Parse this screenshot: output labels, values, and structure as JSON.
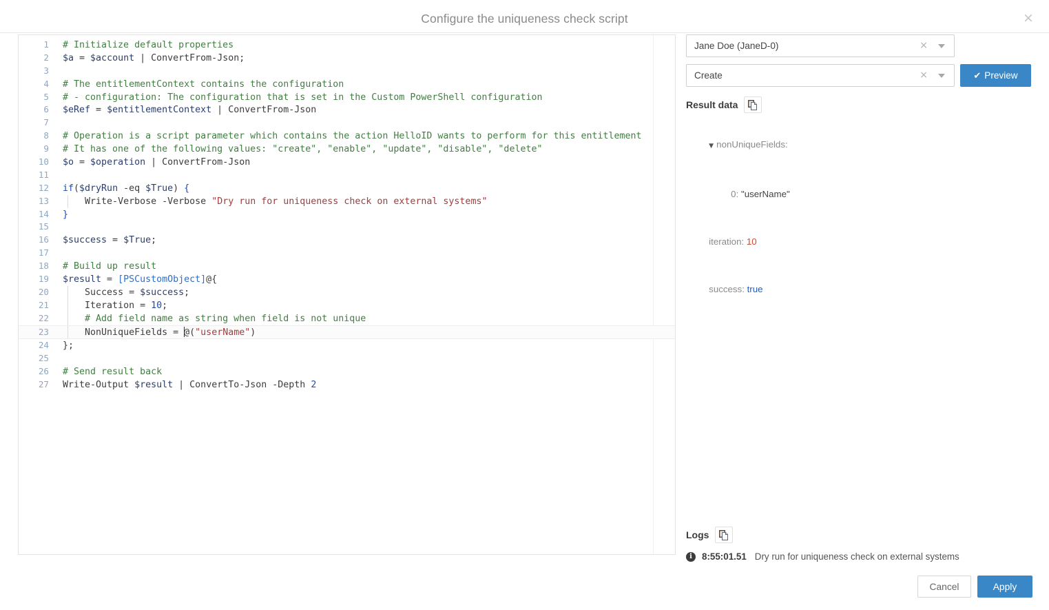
{
  "dialog": {
    "title": "Configure the uniqueness check script",
    "close_label": "×"
  },
  "editor": {
    "language": "powershell",
    "active_line": 23,
    "lines": [
      {
        "n": "1",
        "tokens": [
          {
            "t": "# Initialize default properties",
            "c": "tk-com"
          }
        ]
      },
      {
        "n": "2",
        "tokens": [
          {
            "t": "$a",
            "c": "tk-var"
          },
          {
            "t": " = ",
            "c": "tk-op"
          },
          {
            "t": "$account",
            "c": "tk-var"
          },
          {
            "t": " | ",
            "c": "tk-op"
          },
          {
            "t": "ConvertFrom-Json;",
            "c": "tk-cmd"
          }
        ]
      },
      {
        "n": "3",
        "tokens": []
      },
      {
        "n": "4",
        "tokens": [
          {
            "t": "# The entitlementContext contains the configuration",
            "c": "tk-com"
          }
        ]
      },
      {
        "n": "5",
        "tokens": [
          {
            "t": "# - configuration: The configuration that is set in the Custom PowerShell configuration",
            "c": "tk-com"
          }
        ]
      },
      {
        "n": "6",
        "tokens": [
          {
            "t": "$eRef",
            "c": "tk-var"
          },
          {
            "t": " = ",
            "c": "tk-op"
          },
          {
            "t": "$entitlementContext",
            "c": "tk-var"
          },
          {
            "t": " | ",
            "c": "tk-op"
          },
          {
            "t": "ConvertFrom-Json",
            "c": "tk-cmd"
          }
        ]
      },
      {
        "n": "7",
        "tokens": []
      },
      {
        "n": "8",
        "tokens": [
          {
            "t": "# Operation is a script parameter which contains the action HelloID wants to perform for this entitlement",
            "c": "tk-com"
          }
        ]
      },
      {
        "n": "9",
        "tokens": [
          {
            "t": "# It has one of the following values: \"create\", \"enable\", \"update\", \"disable\", \"delete\"",
            "c": "tk-com"
          }
        ]
      },
      {
        "n": "10",
        "tokens": [
          {
            "t": "$o",
            "c": "tk-var"
          },
          {
            "t": " = ",
            "c": "tk-op"
          },
          {
            "t": "$operation",
            "c": "tk-var"
          },
          {
            "t": " | ",
            "c": "tk-op"
          },
          {
            "t": "ConvertFrom-Json",
            "c": "tk-cmd"
          }
        ]
      },
      {
        "n": "11",
        "tokens": []
      },
      {
        "n": "12",
        "tokens": [
          {
            "t": "if",
            "c": "tk-kw"
          },
          {
            "t": "(",
            "c": "tk-pun"
          },
          {
            "t": "$dryRun",
            "c": "tk-var"
          },
          {
            "t": " -eq ",
            "c": "tk-op"
          },
          {
            "t": "$True",
            "c": "tk-var"
          },
          {
            "t": ") ",
            "c": "tk-pun"
          },
          {
            "t": "{",
            "c": "tk-kw"
          }
        ]
      },
      {
        "n": "13",
        "guide": 1,
        "tokens": [
          {
            "t": "    ",
            "c": "tk-pun"
          },
          {
            "t": "Write-Verbose",
            "c": "tk-cmd"
          },
          {
            "t": " ",
            "c": "tk-op"
          },
          {
            "t": "-Verbose",
            "c": "tk-cmd"
          },
          {
            "t": " ",
            "c": "tk-op"
          },
          {
            "t": "\"Dry run for uniqueness check on external systems\"",
            "c": "tk-str"
          }
        ]
      },
      {
        "n": "14",
        "tokens": [
          {
            "t": "}",
            "c": "tk-kw"
          }
        ]
      },
      {
        "n": "15",
        "tokens": []
      },
      {
        "n": "16",
        "tokens": [
          {
            "t": "$success",
            "c": "tk-var"
          },
          {
            "t": " = ",
            "c": "tk-op"
          },
          {
            "t": "$True",
            "c": "tk-var"
          },
          {
            "t": ";",
            "c": "tk-pun"
          }
        ]
      },
      {
        "n": "17",
        "tokens": []
      },
      {
        "n": "18",
        "tokens": [
          {
            "t": "# Build up result",
            "c": "tk-com"
          }
        ]
      },
      {
        "n": "19",
        "tokens": [
          {
            "t": "$result",
            "c": "tk-var"
          },
          {
            "t": " = ",
            "c": "tk-op"
          },
          {
            "t": "[PSCustomObject]",
            "c": "tk-type"
          },
          {
            "t": "@{",
            "c": "tk-pun"
          }
        ]
      },
      {
        "n": "20",
        "guide": 1,
        "tokens": [
          {
            "t": "    ",
            "c": "tk-pun"
          },
          {
            "t": "Success",
            "c": "tk-cmd"
          },
          {
            "t": " = ",
            "c": "tk-op"
          },
          {
            "t": "$success",
            "c": "tk-var"
          },
          {
            "t": ";",
            "c": "tk-pun"
          }
        ]
      },
      {
        "n": "21",
        "guide": 1,
        "tokens": [
          {
            "t": "    ",
            "c": "tk-pun"
          },
          {
            "t": "Iteration",
            "c": "tk-cmd"
          },
          {
            "t": " = ",
            "c": "tk-op"
          },
          {
            "t": "10",
            "c": "tk-num"
          },
          {
            "t": ";",
            "c": "tk-pun"
          }
        ]
      },
      {
        "n": "22",
        "guide": 1,
        "tokens": [
          {
            "t": "    ",
            "c": "tk-pun"
          },
          {
            "t": "# Add field name as string when field is not unique",
            "c": "tk-com"
          }
        ]
      },
      {
        "n": "23",
        "guide": 1,
        "active": true,
        "tokens": [
          {
            "t": "    ",
            "c": "tk-pun"
          },
          {
            "t": "NonUniqueFields",
            "c": "tk-cmd"
          },
          {
            "t": " = ",
            "c": "tk-op"
          },
          {
            "t": "@(",
            "c": "tk-pun"
          },
          {
            "t": "\"userName\"",
            "c": "tk-str"
          },
          {
            "t": ")",
            "c": "tk-pun"
          }
        ]
      },
      {
        "n": "24",
        "tokens": [
          {
            "t": "};",
            "c": "tk-pun"
          }
        ]
      },
      {
        "n": "25",
        "tokens": []
      },
      {
        "n": "26",
        "tokens": [
          {
            "t": "# Send result back",
            "c": "tk-com"
          }
        ]
      },
      {
        "n": "27",
        "tokens": [
          {
            "t": "Write-Output",
            "c": "tk-cmd"
          },
          {
            "t": " ",
            "c": "tk-op"
          },
          {
            "t": "$result",
            "c": "tk-var"
          },
          {
            "t": " | ",
            "c": "tk-op"
          },
          {
            "t": "ConvertTo-Json",
            "c": "tk-cmd"
          },
          {
            "t": " ",
            "c": "tk-op"
          },
          {
            "t": "-Depth",
            "c": "tk-cmd"
          },
          {
            "t": " ",
            "c": "tk-op"
          },
          {
            "t": "2",
            "c": "tk-num"
          }
        ]
      }
    ]
  },
  "preview_panel": {
    "person_select": {
      "value": "Jane Doe (JaneD-0)",
      "clear_label": "×"
    },
    "action_select": {
      "value": "Create",
      "clear_label": "×"
    },
    "preview_button": {
      "label": "Preview",
      "check": "✔"
    },
    "result_data": {
      "title": "Result data",
      "tree": {
        "nonUniqueFields_key": "nonUniqueFields:",
        "nonUniqueFields_toggle": "▼",
        "item_index": "0:",
        "item_value": "\"userName\"",
        "iteration_key": "iteration:",
        "iteration_value": "10",
        "success_key": "success:",
        "success_value": "true"
      }
    },
    "logs": {
      "title": "Logs",
      "entries": [
        {
          "icon": "i",
          "time": "8:55:01.51",
          "message": "Dry run for uniqueness check on external systems"
        }
      ]
    }
  },
  "footer": {
    "cancel_label": "Cancel",
    "apply_label": "Apply"
  },
  "colors": {
    "accent": "#3a87c8",
    "comment": "#3f7f3f",
    "string": "#a33c3c",
    "keyword": "#1b4ea8",
    "json_number": "#d14836",
    "json_bool": "#1a5fd0"
  }
}
